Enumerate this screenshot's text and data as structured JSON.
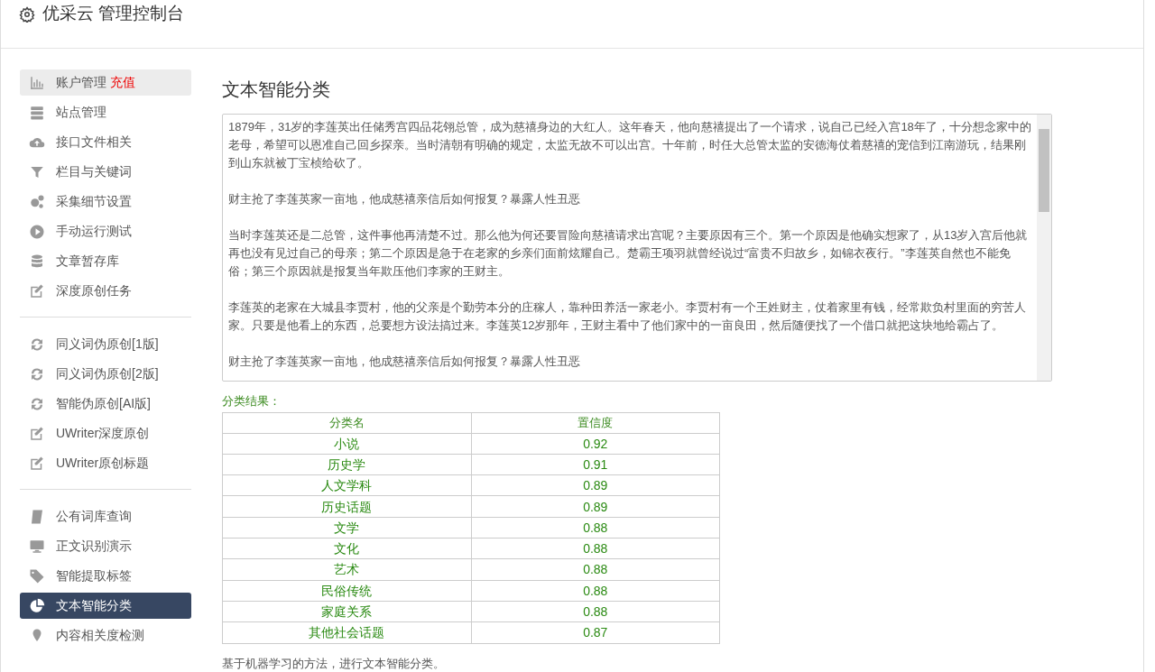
{
  "header": {
    "title": "优采云 管理控制台"
  },
  "sidebar": {
    "groups": [
      {
        "items": [
          {
            "label": "账户管理",
            "badge": "充值",
            "selected": false,
            "hover": true
          },
          {
            "label": "站点管理",
            "selected": false,
            "hover": false
          },
          {
            "label": "接口文件相关",
            "selected": false,
            "hover": false
          },
          {
            "label": "栏目与关键词",
            "selected": false,
            "hover": false
          },
          {
            "label": "采集细节设置",
            "selected": false,
            "hover": false
          },
          {
            "label": "手动运行测试",
            "selected": false,
            "hover": false
          },
          {
            "label": "文章暂存库",
            "selected": false,
            "hover": false
          },
          {
            "label": "深度原创任务",
            "selected": false,
            "hover": false
          }
        ]
      },
      {
        "items": [
          {
            "label": "同义词伪原创[1版]",
            "selected": false,
            "hover": false
          },
          {
            "label": "同义词伪原创[2版]",
            "selected": false,
            "hover": false
          },
          {
            "label": "智能伪原创[AI版]",
            "selected": false,
            "hover": false
          },
          {
            "label": "UWriter深度原创",
            "selected": false,
            "hover": false
          },
          {
            "label": "UWriter原创标题",
            "selected": false,
            "hover": false
          }
        ]
      },
      {
        "items": [
          {
            "label": "公有词库查询",
            "selected": false,
            "hover": false
          },
          {
            "label": "正文识别演示",
            "selected": false,
            "hover": false
          },
          {
            "label": "智能提取标签",
            "selected": false,
            "hover": false
          },
          {
            "label": "文本智能分类",
            "selected": true,
            "hover": false
          },
          {
            "label": "内容相关度检测",
            "selected": false,
            "hover": false
          }
        ]
      }
    ]
  },
  "main": {
    "title": "文本智能分类",
    "text_input": {
      "paragraphs": [
        "1879年，31岁的李莲英出任储秀宫四品花翎总管，成为慈禧身边的大红人。这年春天，他向慈禧提出了一个请求，说自己已经入宫18年了，十分想念家中的老母，希望可以恩准自己回乡探亲。当时清朝有明确的规定，太监无故不可以出宫。十年前，时任大总管太监的安德海仗着慈禧的宠信到江南游玩，结果刚到山东就被丁宝桢给砍了。",
        "财主抢了李莲英家一亩地，他成慈禧亲信后如何报复？暴露人性丑恶",
        "当时李莲英还是二总管，这件事他再清楚不过。那么他为何还要冒险向慈禧请求出宫呢？主要原因有三个。第一个原因是他确实想家了，从13岁入宫后他就再也没有见过自己的母亲；第二个原因是急于在老家的乡亲们面前炫耀自己。楚霸王项羽就曾经说过“富贵不归故乡，如锦衣夜行。”李莲英自然也不能免俗；第三个原因就是报复当年欺压他们李家的王财主。",
        "李莲英的老家在大城县李贾村，他的父亲是个勤劳本分的庄稼人，靠种田养活一家老小。李贾村有一个王姓财主，仗着家里有钱，经常欺负村里面的穷苦人家。只要是他看上的东西，总要想方设法搞过来。李莲英12岁那年，王财主看中了他们家中的一亩良田，然后随便找了一个借口就把这块地给霸占了。",
        "财主抢了李莲英家一亩地，他成慈禧亲信后如何报复？暴露人性丑恶"
      ]
    },
    "result_label": "分类结果：",
    "table": {
      "columns": [
        "分类名",
        "置信度"
      ],
      "rows": [
        [
          "小说",
          "0.92"
        ],
        [
          "历史学",
          "0.91"
        ],
        [
          "人文学科",
          "0.89"
        ],
        [
          "历史话题",
          "0.89"
        ],
        [
          "文学",
          "0.88"
        ],
        [
          "文化",
          "0.88"
        ],
        [
          "艺术",
          "0.88"
        ],
        [
          "民俗传统",
          "0.88"
        ],
        [
          "家庭关系",
          "0.88"
        ],
        [
          "其他社会话题",
          "0.87"
        ]
      ]
    },
    "description": "基于机器学习的方法，进行文本智能分类。"
  }
}
